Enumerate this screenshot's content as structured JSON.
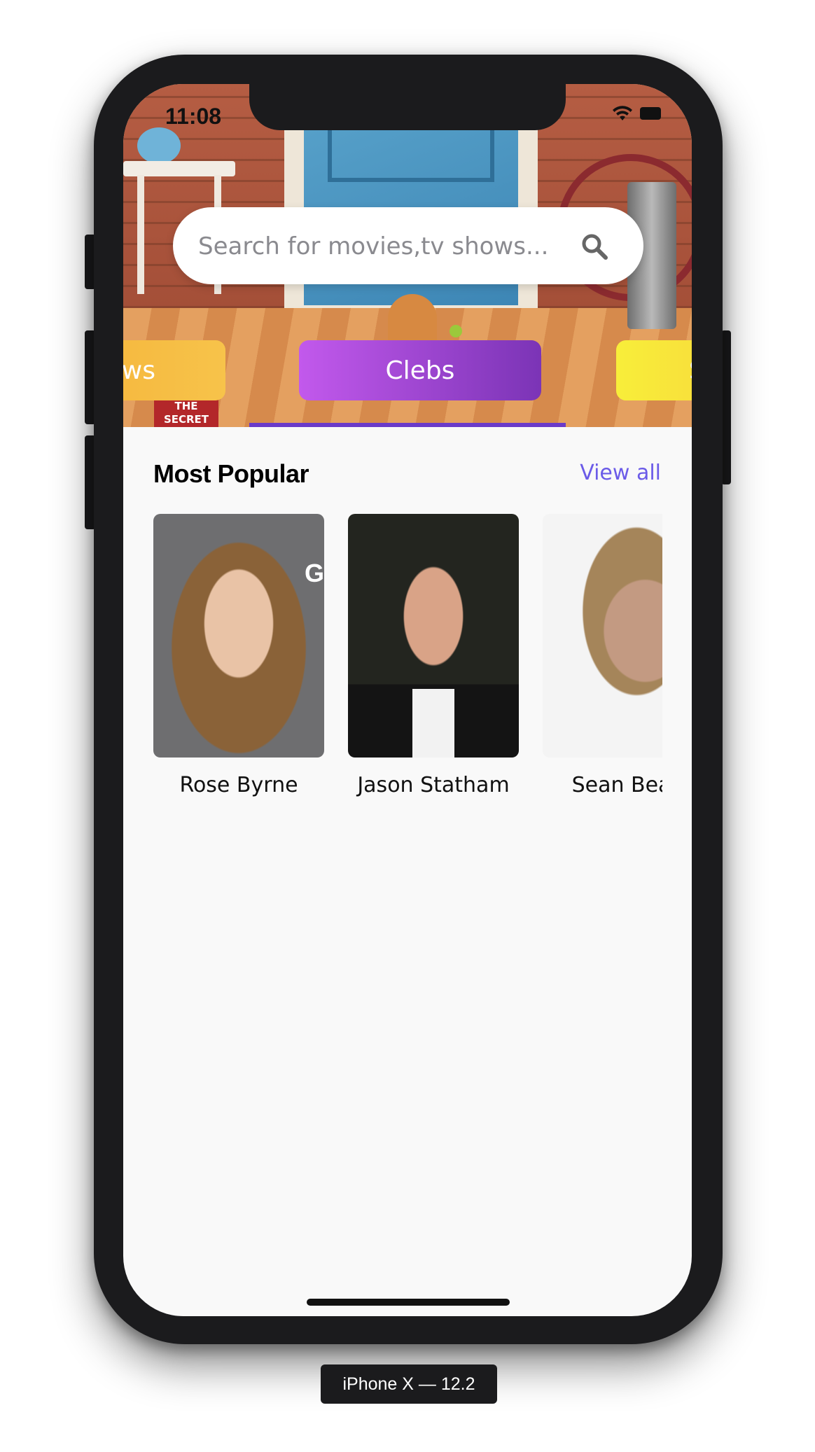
{
  "status_bar": {
    "time": "11:08"
  },
  "search": {
    "placeholder": "Search for movies,tv shows..."
  },
  "hero": {
    "poster_text": "THE SECRET LIFE OF"
  },
  "tabs": [
    {
      "label": "ows"
    },
    {
      "label": "Clebs",
      "active": true
    },
    {
      "label": "S"
    }
  ],
  "section": {
    "title": "Most Popular",
    "view_all": "View all"
  },
  "celebs": [
    {
      "name": "Rose Byrne"
    },
    {
      "name": "Jason Statham"
    },
    {
      "name": "Sean Bean"
    }
  ],
  "device_label": "iPhone X — 12.2",
  "colors": {
    "accent": "#6b5be8",
    "tab_active_start": "#c259ec",
    "tab_active_end": "#7b34b6"
  }
}
